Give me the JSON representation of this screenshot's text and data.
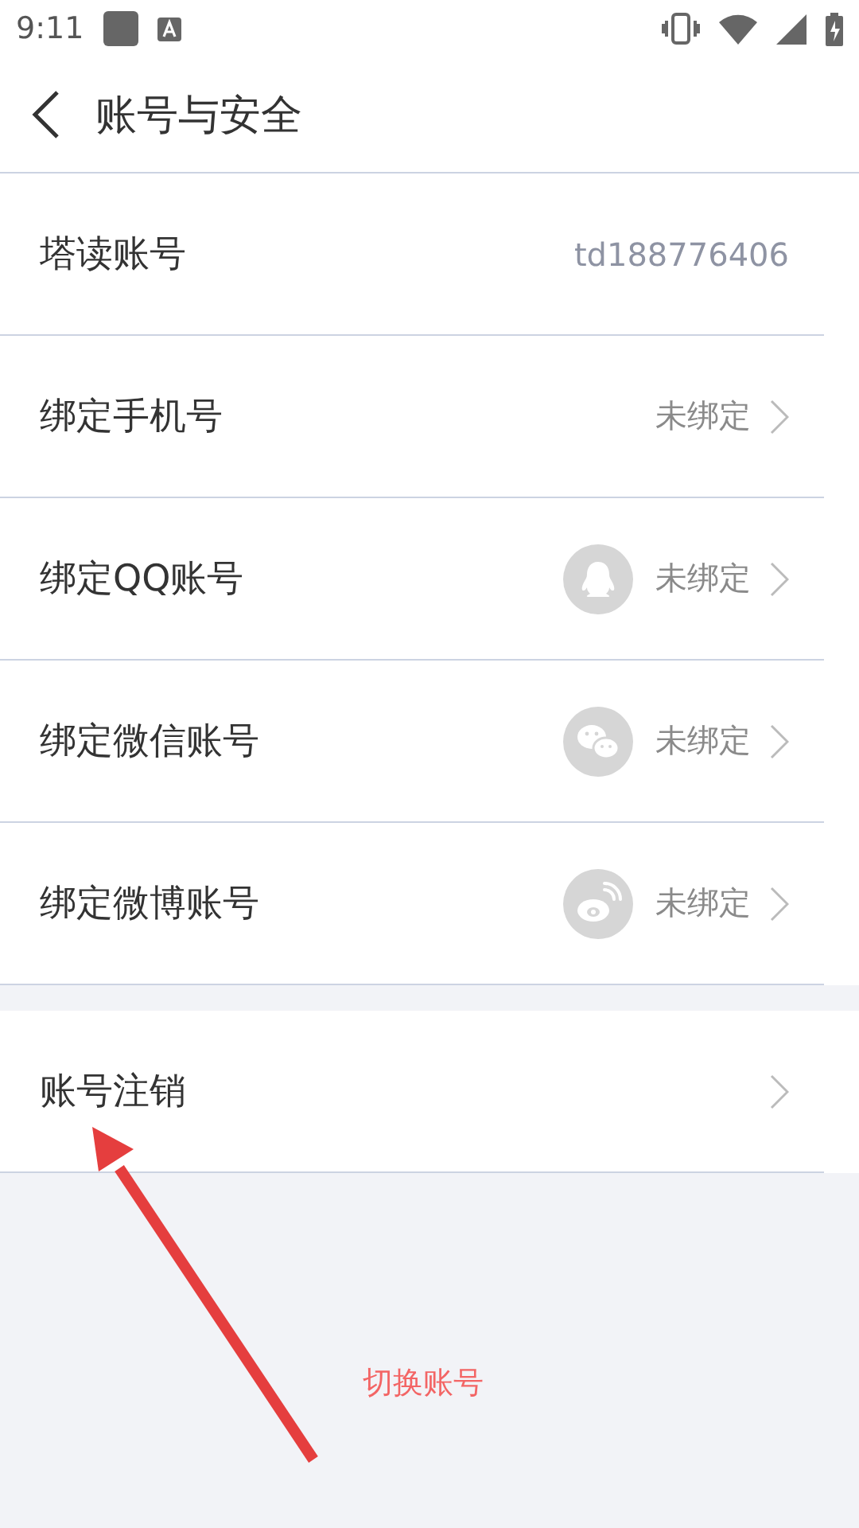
{
  "status_bar": {
    "time": "9:11"
  },
  "header": {
    "title": "账号与安全"
  },
  "settings": [
    {
      "kind": "value",
      "label": "塔读账号",
      "value": "td188776406"
    },
    {
      "kind": "link",
      "label": "绑定手机号",
      "value": "未绑定"
    },
    {
      "kind": "social",
      "label": "绑定QQ账号",
      "value": "未绑定"
    },
    {
      "kind": "social",
      "label": "绑定微信账号",
      "value": "未绑定"
    },
    {
      "kind": "social",
      "label": "绑定微博账号",
      "value": "未绑定"
    }
  ],
  "account_actions": [
    {
      "kind": "link",
      "label": "账号注销"
    }
  ],
  "annotation": {
    "text": "切换账号"
  }
}
